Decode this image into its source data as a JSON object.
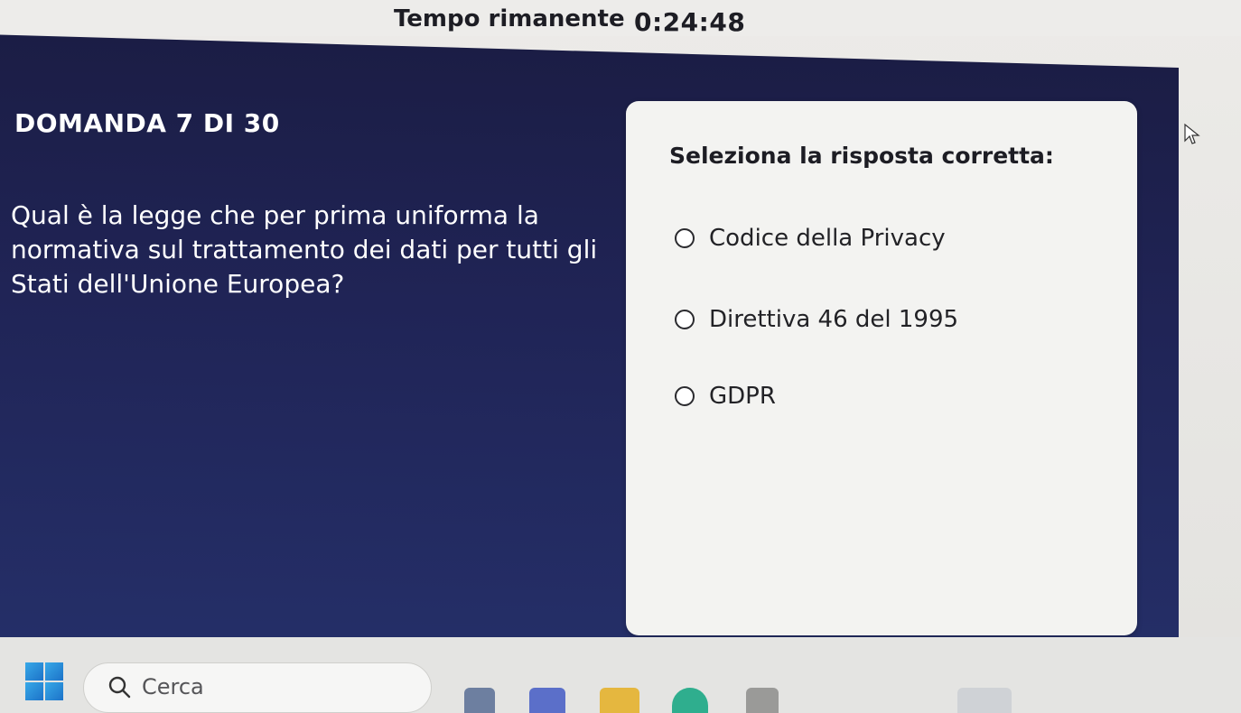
{
  "timer": {
    "label": "Tempo rimanente",
    "value": "0:24:48"
  },
  "question": {
    "header": "DOMANDA  7 DI 30",
    "text": "Qual è la legge che per prima uniforma la normativa sul trattamento dei dati per tutti gli Stati dell'Unione Europea?"
  },
  "answers": {
    "prompt": "Seleziona la risposta corretta:",
    "options": [
      {
        "label": "Codice della Privacy"
      },
      {
        "label": "Direttiva 46 del 1995"
      },
      {
        "label": "GDPR"
      }
    ]
  },
  "taskbar": {
    "search_label": "Cerca"
  },
  "colors": {
    "panel": "#1f2352",
    "card": "#f3f3f1",
    "accent_blue": "#1c72c8"
  }
}
